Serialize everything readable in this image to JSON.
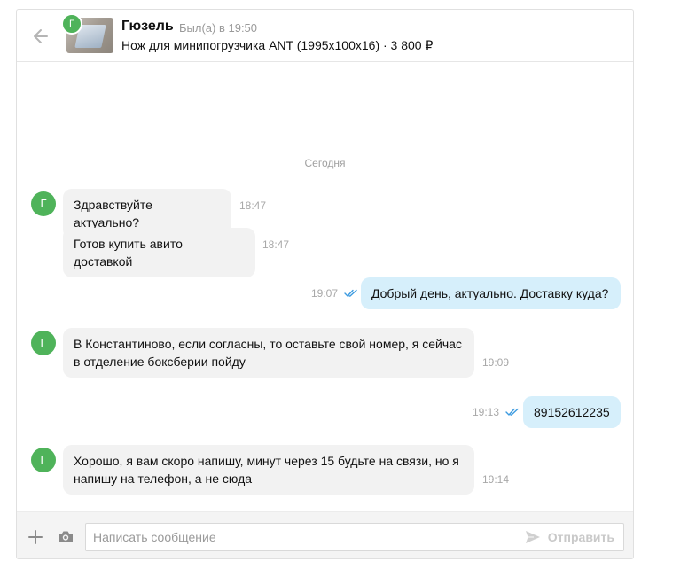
{
  "header": {
    "contact_name": "Гюзель",
    "last_seen": "Был(а) в 19:50",
    "item_title": "Нож для минипогрузчика ANT (1995х100х16) · 3 800 ₽",
    "avatar_letter": "Г"
  },
  "messages": {
    "date_separator": "Сегодня",
    "list": [
      {
        "direction": "in",
        "text": "Здравствуйте актуально?",
        "time": "18:47",
        "avatar": "Г"
      },
      {
        "direction": "in",
        "text": "Готов купить авито доставкой",
        "time": "18:47"
      },
      {
        "direction": "out",
        "text": "Добрый день, актуально. Доставку куда?",
        "time": "19:07",
        "status": "read"
      },
      {
        "direction": "in",
        "text": "В Константиново, если согласны, то оставьте свой номер, я сейчас в отделение боксберии пойду",
        "time": "19:09",
        "avatar": "Г"
      },
      {
        "direction": "out",
        "text": "89152612235",
        "time": "19:13",
        "status": "read"
      },
      {
        "direction": "in",
        "text": "Хорошо, я вам скоро напишу, минут через 15 будьте на связи, но я напишу на телефон, а не сюда",
        "time": "19:14",
        "avatar": "Г"
      }
    ]
  },
  "composer": {
    "placeholder": "Написать сообщение",
    "value": "",
    "send_label": "Отправить"
  },
  "colors": {
    "avatar_green": "#4fb35a",
    "incoming_bubble": "#f2f2f2",
    "outgoing_bubble": "#d6effb",
    "read_check": "#3d9be0"
  },
  "icons": {
    "back": "arrow-left-icon",
    "plus": "plus-icon",
    "camera": "camera-icon",
    "send": "paper-plane-icon",
    "read": "double-check-icon"
  }
}
